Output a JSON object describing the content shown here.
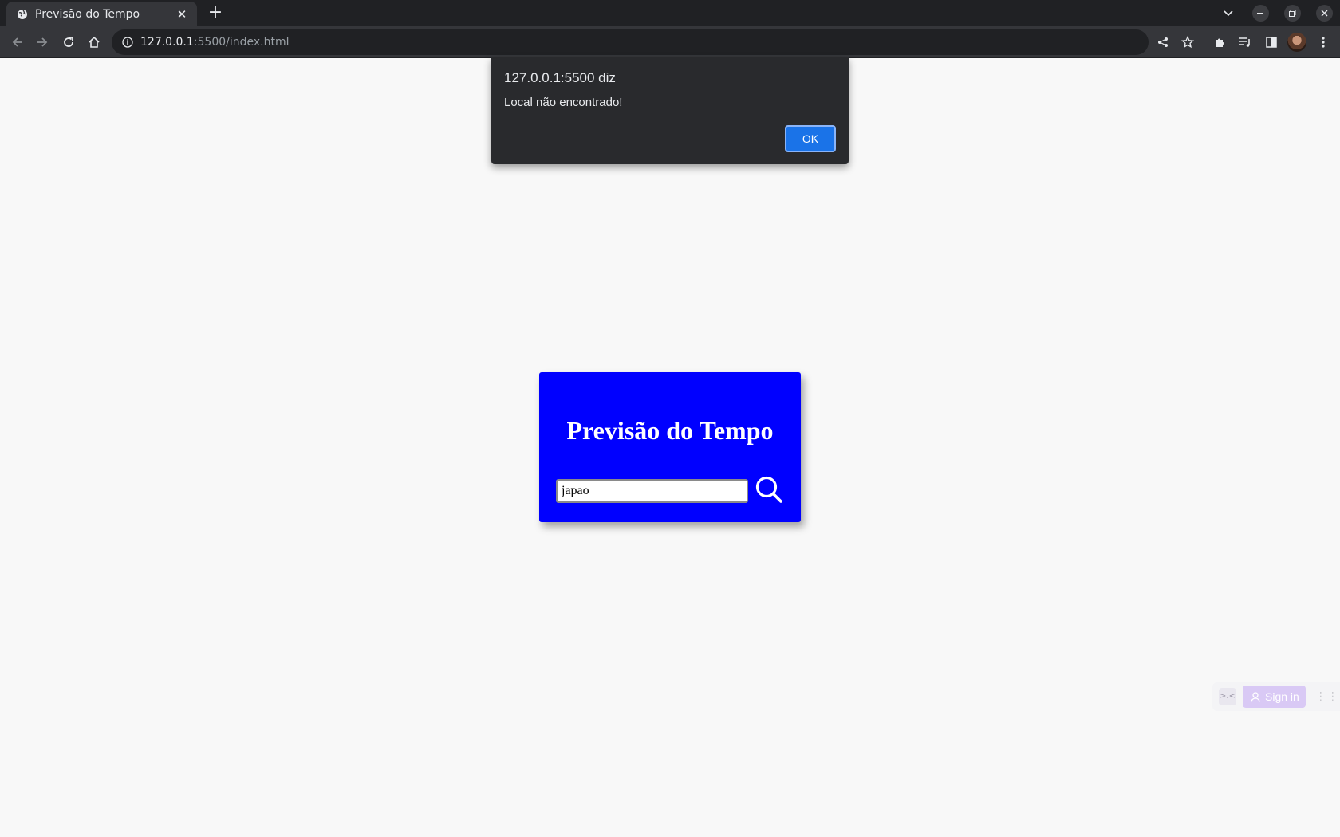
{
  "browser": {
    "tab_title": "Previsão do Tempo",
    "url_host": "127.0.0.1",
    "url_rest": ":5500/index.html"
  },
  "page": {
    "heading": "Previsão do Tempo",
    "search_value": "japao",
    "card_color": "#0000ff"
  },
  "dialog": {
    "title": "127.0.0.1:5500 diz",
    "message": "Local não encontrado!",
    "ok_label": "OK"
  },
  "extension": {
    "signin_label": "Sign in"
  },
  "icons": [
    "globe-icon",
    "close-icon",
    "plus-icon",
    "chevron-down-icon",
    "minimize-icon",
    "maximize-icon",
    "back-icon",
    "forward-icon",
    "reload-icon",
    "home-icon",
    "info-icon",
    "share-icon",
    "star-icon",
    "puzzle-icon",
    "playlist-icon",
    "sidepanel-icon",
    "menu-dots-icon",
    "search-icon",
    "user-icon",
    "drag-handle-icon"
  ]
}
